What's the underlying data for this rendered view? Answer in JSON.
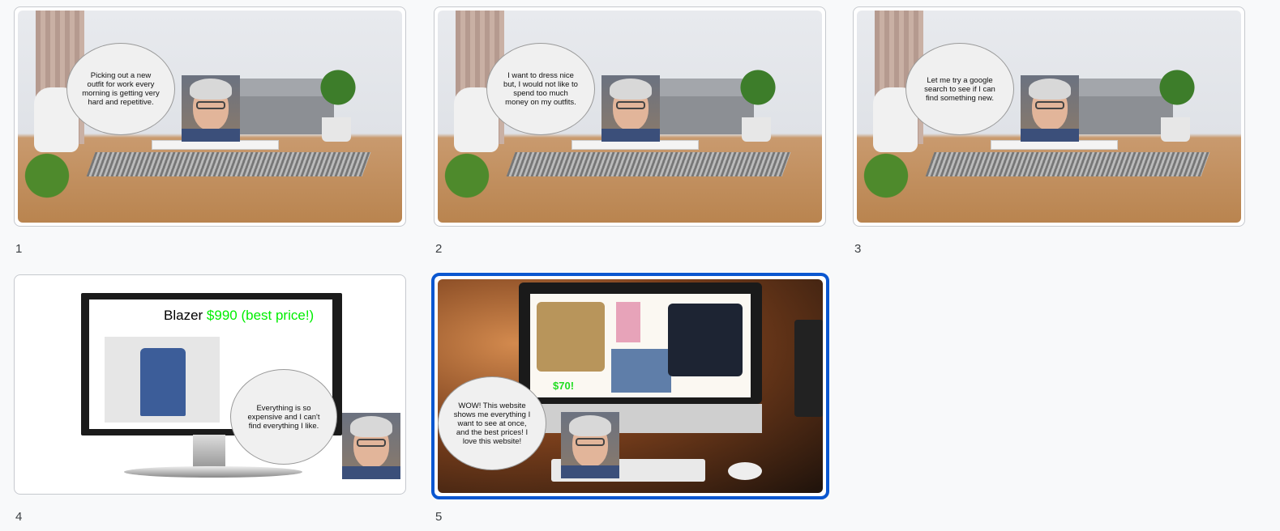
{
  "slides": [
    {
      "number": "1",
      "speech": "Picking out a new outfit for work every morning is getting very hard and repetitive."
    },
    {
      "number": "2",
      "speech": "I want to dress nice but, I would not like to spend too much money on my outfits."
    },
    {
      "number": "3",
      "speech": "Let me try a google search to see if I can find something new."
    },
    {
      "number": "4",
      "speech": "Everything is so expensive and I can't find everything I like.",
      "title_item": "Blazer",
      "title_price": "$990 (best price!)"
    },
    {
      "number": "5",
      "speech": "WOW!  This website shows me everything I want to see at once, and the best prices! I love this website!",
      "price_tag": "$70!"
    }
  ],
  "colors": {
    "selection": "#0b57d0",
    "price_green": "#00ee00"
  },
  "selected_slide": "5"
}
